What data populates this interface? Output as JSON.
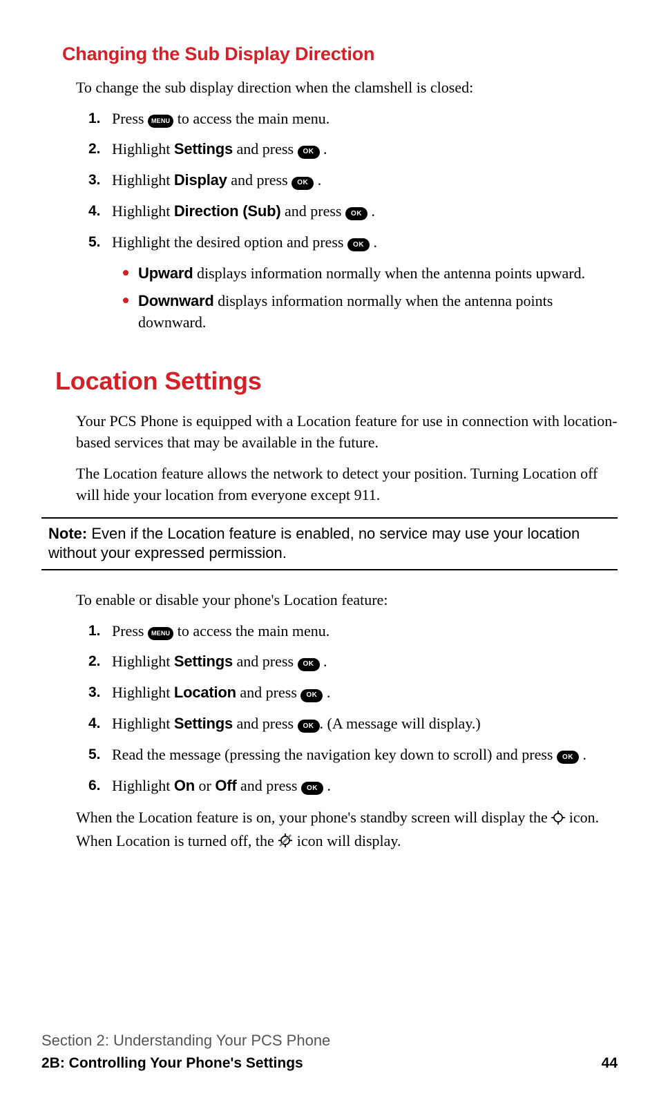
{
  "section1": {
    "heading": "Changing the Sub Display Direction",
    "intro": "To change the sub display direction when the clamshell is closed:",
    "steps": [
      {
        "num": "1.",
        "pre": "Press ",
        "btn": "MENU",
        "post": " to access the main menu."
      },
      {
        "num": "2.",
        "pre": "Highlight ",
        "hl": "Settings",
        "mid": " and press ",
        "btn": "OK",
        "post": "."
      },
      {
        "num": "3.",
        "pre": "Highlight ",
        "hl": "Display",
        "mid": " and press ",
        "btn": "OK",
        "post": "."
      },
      {
        "num": "4.",
        "pre": "Highlight ",
        "hl": "Direction (Sub)",
        "mid": " and press ",
        "btn": "OK",
        "post": "."
      },
      {
        "num": "5.",
        "pre": "Highlight the desired option and press ",
        "btn": "OK",
        "post": "."
      }
    ],
    "bullets": [
      {
        "hl": "Upward",
        "text": " displays information normally when the antenna points upward."
      },
      {
        "hl": "Downward",
        "text": " displays information normally when the antenna points downward."
      }
    ]
  },
  "section2": {
    "heading": "Location Settings",
    "para1": "Your PCS Phone is equipped with a Location feature for use in connection with location-based services that may be available in the future.",
    "para2": "The Location feature allows the network to detect your position. Turning Location off will hide your location from everyone except 911.",
    "note_label": "Note:",
    "note_text": " Even if the Location feature is enabled, no service may use your location without your expressed permission.",
    "intro2": "To enable or disable your phone's Location feature:",
    "steps": [
      {
        "num": "1.",
        "pre": "Press ",
        "btn": "MENU",
        "post": " to access the main menu."
      },
      {
        "num": "2.",
        "pre": "Highlight ",
        "hl": "Settings",
        "mid": " and press ",
        "btn": "OK",
        "post": "."
      },
      {
        "num": "3.",
        "pre": "Highlight ",
        "hl": "Location",
        "mid": " and press ",
        "btn": "OK",
        "post": "."
      },
      {
        "num": "4.",
        "pre": "Highlight ",
        "hl": "Settings",
        "mid": " and press ",
        "btn": "OK",
        "post": ". (A message will display.)"
      },
      {
        "num": "5.",
        "pre": "Read the message (pressing the navigation key down to scroll) and press ",
        "btn": "OK",
        "post": "."
      },
      {
        "num": "6.",
        "pre": "Highlight ",
        "hl": "On",
        "mid2": " or ",
        "hl2": "Off",
        "mid": " and press ",
        "btn": "OK",
        "post": "."
      }
    ],
    "closing_pre": "When the Location feature is on, your phone's standby screen will display the ",
    "closing_mid": " icon. When Location is turned off, the ",
    "closing_post": " icon will display."
  },
  "footer": {
    "section_line": "Section 2: Understanding Your PCS Phone",
    "chapter": "2B: Controlling Your Phone's Settings",
    "page": "44"
  },
  "icons": {
    "menu": "MENU",
    "ok": "OK",
    "location_on": "location-on-icon",
    "location_off": "location-off-icon"
  }
}
